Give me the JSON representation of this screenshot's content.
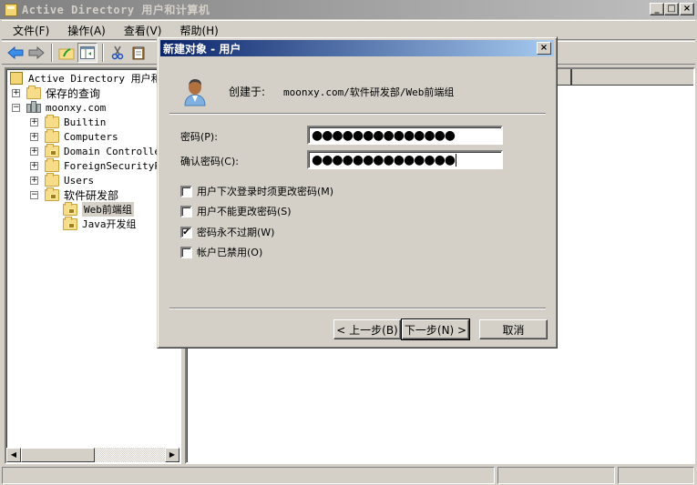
{
  "window": {
    "title": "Active Directory 用户和计算机",
    "controls": {
      "minimize": "_",
      "maximize": "□",
      "close": "×"
    }
  },
  "menubar": {
    "items": [
      {
        "label": "文件(F)"
      },
      {
        "label": "操作(A)"
      },
      {
        "label": "查看(V)"
      },
      {
        "label": "帮助(H)"
      }
    ]
  },
  "toolbar": {
    "buttons": [
      {
        "icon": "back-arrow-icon"
      },
      {
        "icon": "forward-arrow-icon"
      },
      {
        "icon": "up-folder-icon"
      },
      {
        "icon": "show-hide-console-tree-icon",
        "pressed": true
      },
      {
        "icon": "cut-icon"
      },
      {
        "icon": "paste-icon"
      }
    ]
  },
  "tree": {
    "root": "Active Directory 用户和计",
    "items": [
      {
        "label": "保存的查询",
        "expander": "+"
      },
      {
        "label": "moonxy.com",
        "expander": "−"
      },
      {
        "label": "Builtin",
        "expander": "+"
      },
      {
        "label": "Computers",
        "expander": "+"
      },
      {
        "label": "Domain Controllers",
        "expander": "+"
      },
      {
        "label": "ForeignSecurityPrincipals",
        "expander": "+"
      },
      {
        "label": "Users",
        "expander": "+"
      },
      {
        "label": "软件研发部",
        "expander": "−"
      },
      {
        "label": "Web前端组",
        "selected": true
      },
      {
        "label": "Java开发组"
      }
    ]
  },
  "dialog": {
    "title": "新建对象 - 用户",
    "close": "×",
    "created_in_label": "创建于:",
    "created_in_path": "moonxy.com/软件研发部/Web前端组",
    "password_label": "密码(P):",
    "password_value": "●●●●●●●●●●●●●●",
    "confirm_label": "确认密码(C):",
    "confirm_value": "●●●●●●●●●●●●●●",
    "options": [
      {
        "label": "用户下次登录时须更改密码(M)",
        "checked": false
      },
      {
        "label": "用户不能更改密码(S)",
        "checked": false
      },
      {
        "label": "密码永不过期(W)",
        "checked": true
      },
      {
        "label": "帐户已禁用(O)",
        "checked": false
      }
    ],
    "check_mark": "✔",
    "buttons": {
      "back": "< 上一步(B)",
      "next": "下一步(N) >",
      "cancel": "取消"
    }
  },
  "scrollbar": {
    "left_arrow": "◀",
    "right_arrow": "▶"
  }
}
